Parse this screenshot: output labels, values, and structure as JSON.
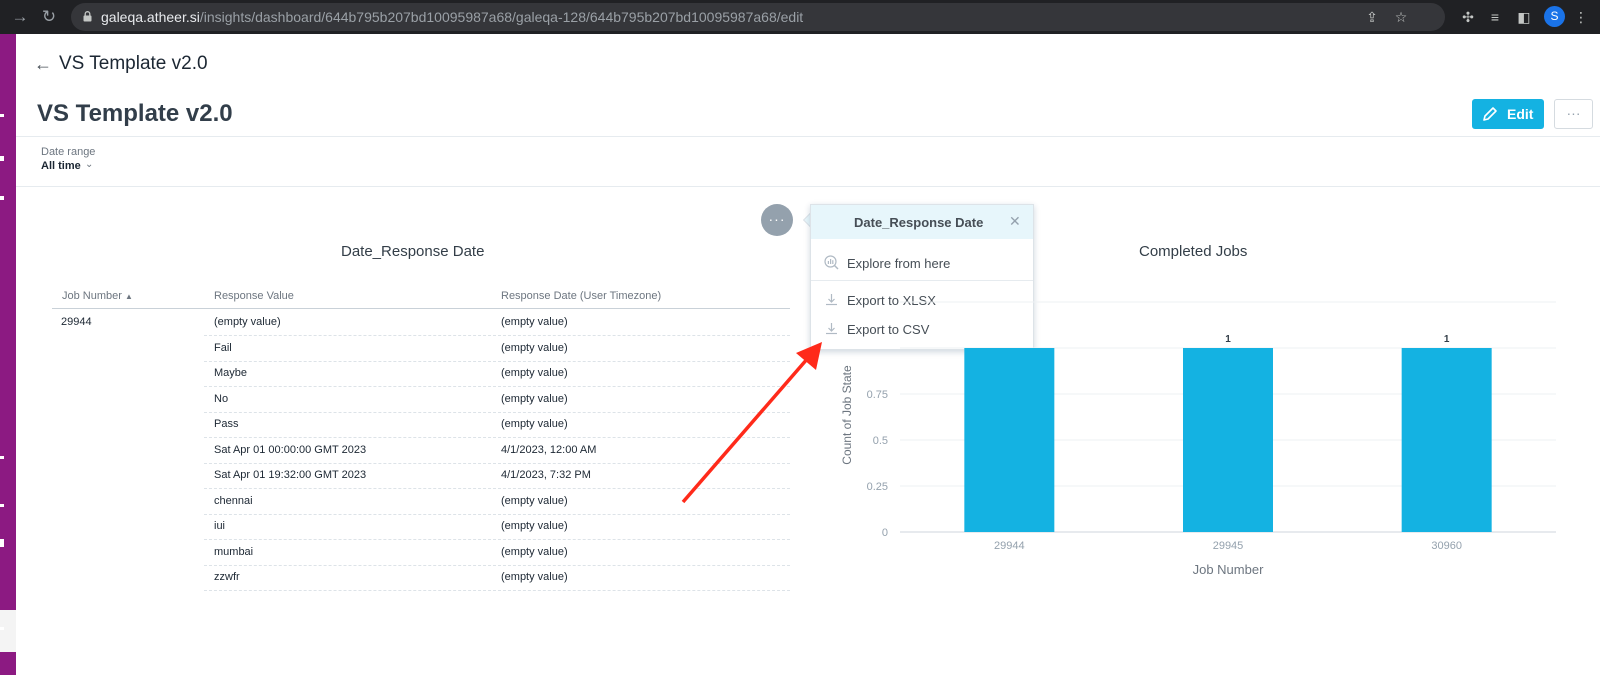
{
  "browser": {
    "url_host": "galeqa.atheer.si",
    "url_path": "/insights/dashboard/644b795b207bd10095987a68/galeqa-128/644b795b207bd10095987a68/edit",
    "profile_initial": "S"
  },
  "header": {
    "breadcrumb_title": "VS Template v2.0",
    "dashboard_title": "VS Template v2.0",
    "edit_label": "Edit",
    "more_label": "···"
  },
  "filters": {
    "date_range_label": "Date range",
    "date_range_value": "All time"
  },
  "table_widget": {
    "title": "Date_Response Date",
    "columns": [
      "Job Number",
      "Response Value",
      "Response Date (User Timezone)"
    ],
    "sort_indicator": "▲",
    "job_number": "29944",
    "rows": [
      {
        "response_value": "(empty value)",
        "response_date": "(empty value)"
      },
      {
        "response_value": "Fail",
        "response_date": "(empty value)"
      },
      {
        "response_value": "Maybe",
        "response_date": "(empty value)"
      },
      {
        "response_value": "No",
        "response_date": "(empty value)"
      },
      {
        "response_value": "Pass",
        "response_date": "(empty value)"
      },
      {
        "response_value": "Sat Apr 01 00:00:00 GMT 2023",
        "response_date": "4/1/2023, 12:00 AM"
      },
      {
        "response_value": "Sat Apr 01 19:32:00 GMT 2023",
        "response_date": "4/1/2023, 7:32 PM"
      },
      {
        "response_value": "chennai",
        "response_date": "(empty value)"
      },
      {
        "response_value": "iui",
        "response_date": "(empty value)"
      },
      {
        "response_value": "mumbai",
        "response_date": "(empty value)"
      },
      {
        "response_value": "zzwfr",
        "response_date": "(empty value)"
      }
    ]
  },
  "popup": {
    "dots_label": "···",
    "title": "Date_Response Date",
    "close_label": "✕",
    "items": [
      {
        "label": "Explore from here",
        "icon": "explore-icon"
      },
      {
        "label": "Export to XLSX",
        "icon": "download-icon"
      },
      {
        "label": "Export to CSV",
        "icon": "download-icon"
      }
    ]
  },
  "chart_data": {
    "type": "bar",
    "title": "Completed Jobs",
    "categories": [
      "29944",
      "29945",
      "30960"
    ],
    "values": [
      1,
      1,
      1
    ],
    "data_labels": [
      "1",
      "1"
    ],
    "xlabel": "Job Number",
    "ylabel": "Count of Job State",
    "y_ticks": [
      "0",
      "0.25",
      "0.5",
      "0.75"
    ],
    "ylim": [
      0,
      1.25
    ],
    "grid": true,
    "bar_color": "#14b2e2"
  },
  "colors": {
    "accent": "#14b2e2",
    "sidebar": "#8c1a82",
    "annotation_arrow": "#ff2a1a"
  }
}
